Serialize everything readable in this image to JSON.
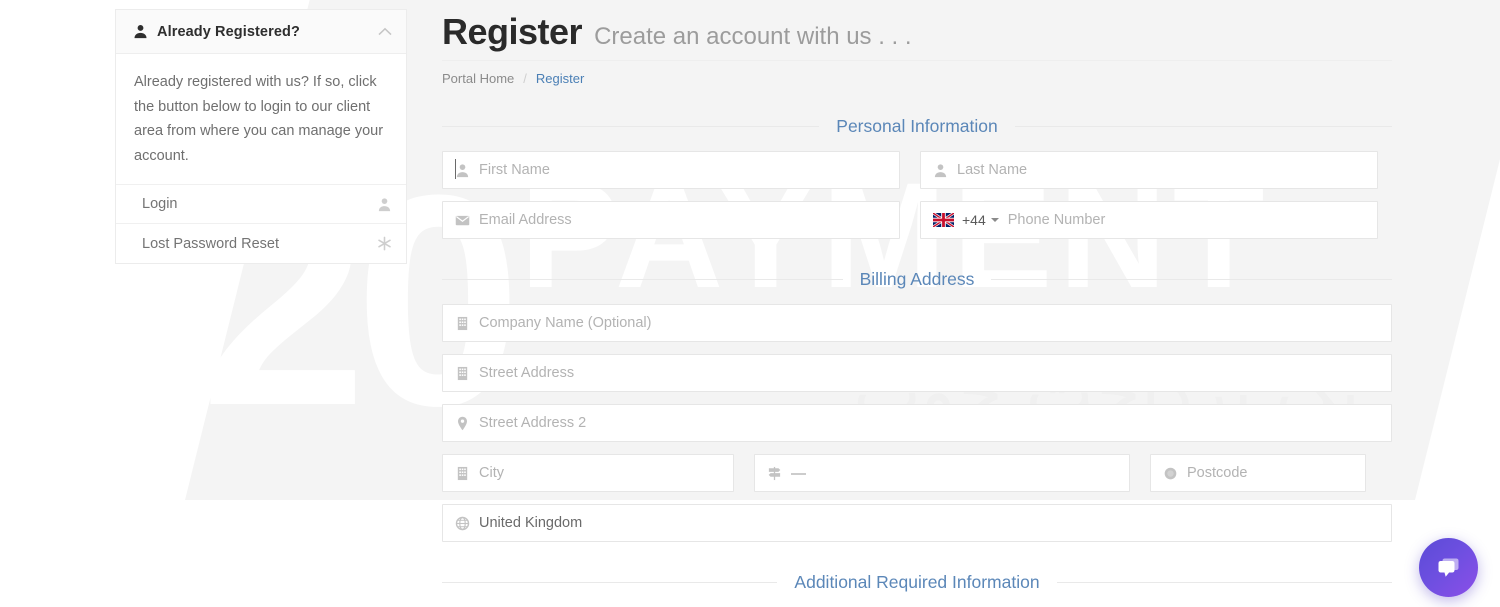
{
  "sidebar": {
    "title": "Already Registered?",
    "user_icon": "user-icon",
    "collapse_icon": "chevron-up-icon",
    "body_text": "Already registered with us? If so, click the button below to login to our client area from where you can manage your account.",
    "links": [
      {
        "label": "Login",
        "icon": "user-icon"
      },
      {
        "label": "Lost Password Reset",
        "icon": "asterisk-icon"
      }
    ]
  },
  "header": {
    "title": "Register",
    "subtitle": "Create an account with us . . ."
  },
  "breadcrumb": {
    "home": "Portal Home",
    "separator": "/",
    "current": "Register"
  },
  "sections": {
    "personal": "Personal Information",
    "billing": "Billing Address",
    "additional": "Additional Required Information"
  },
  "fields": {
    "first_name": {
      "placeholder": "First Name",
      "value": "",
      "icon": "user-icon"
    },
    "last_name": {
      "placeholder": "Last Name",
      "value": "",
      "icon": "user-icon"
    },
    "email": {
      "placeholder": "Email Address",
      "value": "",
      "icon": "envelope-icon"
    },
    "phone": {
      "placeholder": "Phone Number",
      "value": "",
      "dial_code": "+44",
      "flag": "uk-flag-icon"
    },
    "company": {
      "placeholder": "Company Name (Optional)",
      "value": "",
      "icon": "building-icon"
    },
    "street1": {
      "placeholder": "Street Address",
      "value": "",
      "icon": "building-icon"
    },
    "street2": {
      "placeholder": "Street Address 2",
      "value": "",
      "icon": "map-pin-icon"
    },
    "city": {
      "placeholder": "City",
      "value": "",
      "icon": "building-icon"
    },
    "state": {
      "placeholder": "",
      "value": "—",
      "icon": "signpost-icon"
    },
    "postcode": {
      "placeholder": "Postcode",
      "value": "",
      "icon": "circle-badge-icon"
    },
    "country": {
      "placeholder": "",
      "value": "United Kingdom",
      "icon": "globe-icon"
    }
  },
  "watermark": {
    "number": "20",
    "word": "PAYMENT",
    "persian": "یک پرداخت خوب"
  },
  "chat": {
    "icon": "chat-bubble-icon"
  },
  "colors": {
    "section_title": "#5b87b8",
    "breadcrumb_link": "#4a7fb5",
    "chat_accent": "#6d4fe0",
    "field_border": "#e6e6e6",
    "placeholder": "#b3b3b3"
  }
}
